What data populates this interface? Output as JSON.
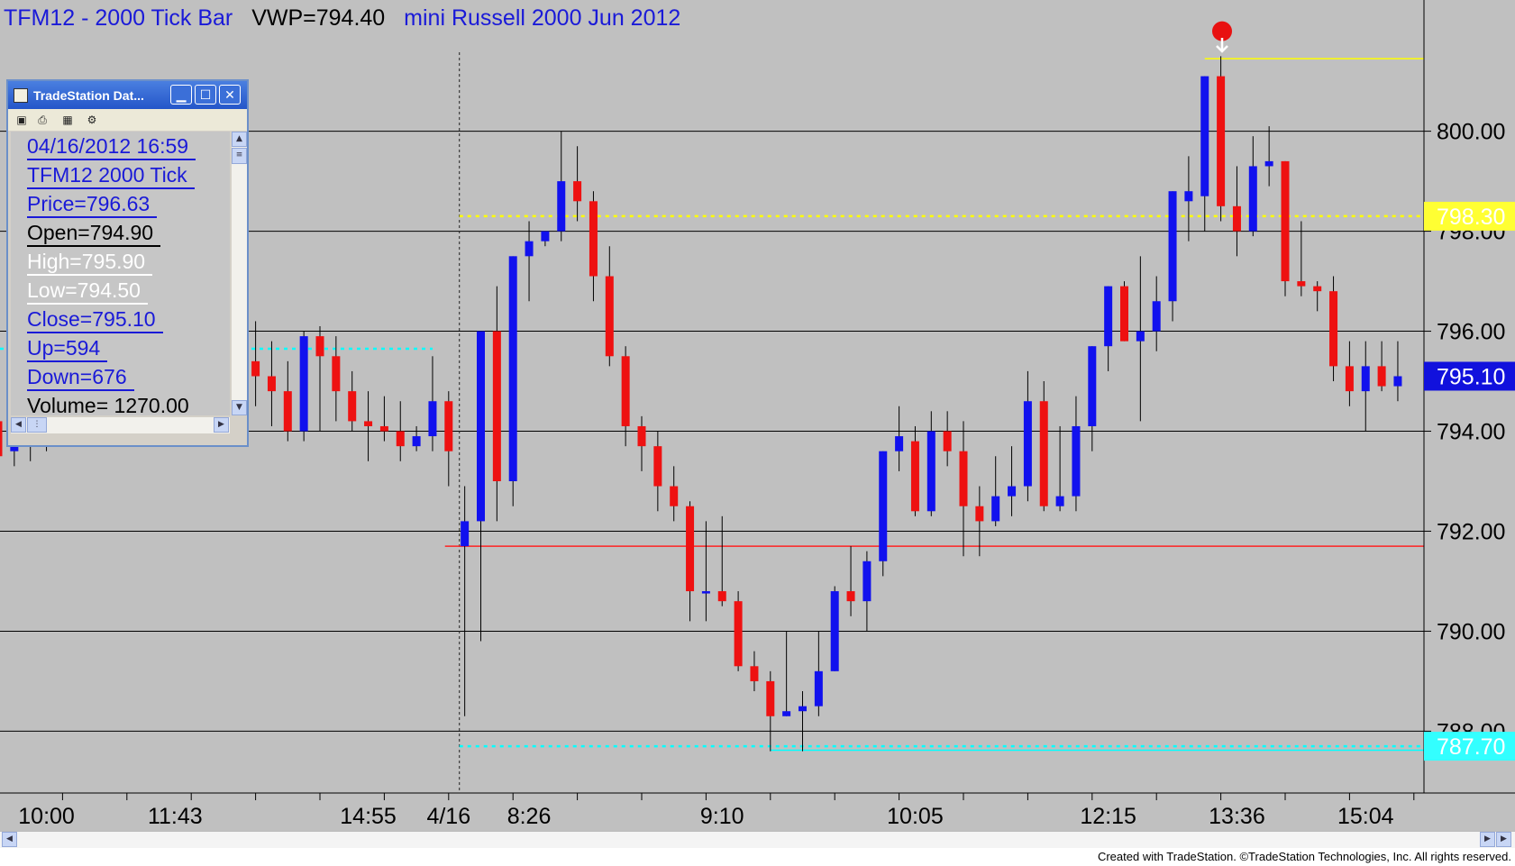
{
  "chart_data": {
    "type": "candlestick",
    "title_parts": [
      "TFM12 - 2000 Tick Bar",
      "VWP=794.40",
      "mini Russell 2000 Jun 2012"
    ],
    "y_ticks": [
      800.0,
      798.0,
      796.0,
      794.0,
      792.0,
      790.0,
      788.0
    ],
    "y_tick_labels": [
      "800.00",
      "798.00",
      "796.00",
      "794.00",
      "792.00",
      "790.00",
      "788.00"
    ],
    "ylim": [
      786.8,
      802.3
    ],
    "x_tick_labels": [
      "10:00",
      "11:43",
      "14:55",
      "4/16",
      "8:26",
      "9:10",
      "10:05",
      "12:15",
      "13:36",
      "15:04"
    ],
    "x_tick_bars": [
      3,
      11,
      23,
      28,
      33,
      45,
      57,
      69,
      77,
      85
    ],
    "bar_count": 90,
    "session_divider_bar": 29,
    "grid": true,
    "candles": [
      {
        "o": 794.2,
        "h": 794.8,
        "c": 793.5,
        "l": 793.3
      },
      {
        "o": 793.6,
        "h": 794.0,
        "c": 794.4,
        "l": 793.3
      },
      {
        "o": 794.3,
        "h": 794.6,
        "c": 793.9,
        "l": 793.4
      },
      {
        "o": 793.8,
        "h": 794.6,
        "c": 794.5,
        "l": 793.6
      },
      {
        "o": 794.5,
        "h": 795.6,
        "c": 795.2,
        "l": 794.1
      },
      {
        "o": 795.2,
        "h": 795.5,
        "c": 794.8,
        "l": 794.4
      },
      {
        "o": 794.8,
        "h": 795.2,
        "c": 795.1,
        "l": 794.5
      },
      {
        "o": 795.1,
        "h": 795.7,
        "c": 795.6,
        "l": 794.9
      },
      {
        "o": 795.6,
        "h": 796.0,
        "c": 795.3,
        "l": 795.0
      },
      {
        "o": 795.3,
        "h": 795.8,
        "c": 795.0,
        "l": 794.7
      },
      {
        "o": 795.0,
        "h": 795.4,
        "c": 794.6,
        "l": 794.3
      },
      {
        "o": 794.6,
        "h": 795.1,
        "c": 794.9,
        "l": 794.2
      },
      {
        "o": 794.9,
        "h": 795.3,
        "c": 795.6,
        "l": 794.6
      },
      {
        "o": 795.6,
        "h": 797.0,
        "c": 796.2,
        "l": 795.4
      },
      {
        "o": 796.2,
        "h": 797.4,
        "c": 796.9,
        "l": 795.9
      },
      {
        "o": 796.9,
        "h": 797.1,
        "c": 795.4,
        "l": 794.9
      },
      {
        "o": 795.4,
        "h": 796.2,
        "c": 795.1,
        "l": 794.5
      },
      {
        "o": 795.1,
        "h": 795.8,
        "c": 794.8,
        "l": 794.1
      },
      {
        "o": 794.8,
        "h": 795.4,
        "c": 794.0,
        "l": 793.8
      },
      {
        "o": 794.0,
        "h": 796.0,
        "c": 795.9,
        "l": 793.8
      },
      {
        "o": 795.9,
        "h": 796.1,
        "c": 795.5,
        "l": 794.0
      },
      {
        "o": 795.5,
        "h": 795.9,
        "c": 794.8,
        "l": 794.2
      },
      {
        "o": 794.8,
        "h": 795.2,
        "c": 794.2,
        "l": 794.0
      },
      {
        "o": 794.2,
        "h": 794.8,
        "c": 794.1,
        "l": 793.4
      },
      {
        "o": 794.1,
        "h": 794.7,
        "c": 794.0,
        "l": 793.8
      },
      {
        "o": 794.0,
        "h": 794.6,
        "c": 793.7,
        "l": 793.4
      },
      {
        "o": 793.7,
        "h": 794.1,
        "c": 793.9,
        "l": 793.6
      },
      {
        "o": 793.9,
        "h": 795.5,
        "c": 794.6,
        "l": 793.6
      },
      {
        "o": 794.6,
        "h": 794.8,
        "c": 793.6,
        "l": 792.9
      },
      {
        "o": 791.7,
        "h": 792.9,
        "c": 792.2,
        "l": 788.3
      },
      {
        "o": 792.2,
        "h": 795.0,
        "c": 796.0,
        "l": 789.8
      },
      {
        "o": 796.0,
        "h": 796.9,
        "c": 793.0,
        "l": 792.2
      },
      {
        "o": 793.0,
        "h": 797.4,
        "c": 797.5,
        "l": 792.5
      },
      {
        "o": 797.5,
        "h": 798.2,
        "c": 797.8,
        "l": 796.6
      },
      {
        "o": 797.8,
        "h": 798.0,
        "c": 798.0,
        "l": 797.7
      },
      {
        "o": 798.0,
        "h": 800.0,
        "c": 799.0,
        "l": 797.8
      },
      {
        "o": 799.0,
        "h": 799.7,
        "c": 798.6,
        "l": 798.2
      },
      {
        "o": 798.6,
        "h": 798.8,
        "c": 797.1,
        "l": 796.6
      },
      {
        "o": 797.1,
        "h": 797.7,
        "c": 795.5,
        "l": 795.3
      },
      {
        "o": 795.5,
        "h": 795.7,
        "c": 794.1,
        "l": 793.7
      },
      {
        "o": 794.1,
        "h": 794.3,
        "c": 793.7,
        "l": 793.2
      },
      {
        "o": 793.7,
        "h": 794.0,
        "c": 792.9,
        "l": 792.4
      },
      {
        "o": 792.9,
        "h": 793.3,
        "c": 792.5,
        "l": 792.2
      },
      {
        "o": 792.5,
        "h": 792.6,
        "c": 790.8,
        "l": 790.2
      },
      {
        "o": 790.8,
        "h": 792.2,
        "c": 790.8,
        "l": 790.2
      },
      {
        "o": 790.8,
        "h": 792.3,
        "c": 790.6,
        "l": 790.5
      },
      {
        "o": 790.6,
        "h": 790.8,
        "c": 789.3,
        "l": 789.2
      },
      {
        "o": 789.3,
        "h": 789.6,
        "c": 789.0,
        "l": 788.8
      },
      {
        "o": 789.0,
        "h": 789.2,
        "c": 788.3,
        "l": 787.6
      },
      {
        "o": 788.3,
        "h": 790.0,
        "c": 788.4,
        "l": 788.3
      },
      {
        "o": 788.4,
        "h": 788.8,
        "c": 788.5,
        "l": 787.6
      },
      {
        "o": 788.5,
        "h": 790.0,
        "c": 789.2,
        "l": 788.3
      },
      {
        "o": 789.2,
        "h": 790.9,
        "c": 790.8,
        "l": 789.3
      },
      {
        "o": 790.8,
        "h": 791.7,
        "c": 790.6,
        "l": 790.3
      },
      {
        "o": 790.6,
        "h": 791.6,
        "c": 791.4,
        "l": 790.0
      },
      {
        "o": 791.4,
        "h": 792.0,
        "c": 793.6,
        "l": 791.1
      },
      {
        "o": 793.6,
        "h": 794.5,
        "c": 793.9,
        "l": 793.2
      },
      {
        "o": 793.8,
        "h": 794.1,
        "c": 792.4,
        "l": 792.3
      },
      {
        "o": 792.4,
        "h": 794.4,
        "c": 794.0,
        "l": 792.3
      },
      {
        "o": 794.0,
        "h": 794.4,
        "c": 793.6,
        "l": 793.3
      },
      {
        "o": 793.6,
        "h": 794.2,
        "c": 792.5,
        "l": 791.5
      },
      {
        "o": 792.5,
        "h": 792.9,
        "c": 792.2,
        "l": 791.5
      },
      {
        "o": 792.2,
        "h": 793.5,
        "c": 792.7,
        "l": 792.1
      },
      {
        "o": 792.7,
        "h": 793.7,
        "c": 792.9,
        "l": 792.3
      },
      {
        "o": 792.9,
        "h": 795.2,
        "c": 794.6,
        "l": 792.6
      },
      {
        "o": 794.6,
        "h": 795.0,
        "c": 792.5,
        "l": 792.4
      },
      {
        "o": 792.5,
        "h": 794.1,
        "c": 792.7,
        "l": 792.4
      },
      {
        "o": 792.7,
        "h": 794.7,
        "c": 794.1,
        "l": 792.4
      },
      {
        "o": 794.1,
        "h": 795.6,
        "c": 795.7,
        "l": 793.6
      },
      {
        "o": 795.7,
        "h": 796.9,
        "c": 796.9,
        "l": 795.2
      },
      {
        "o": 796.9,
        "h": 797.0,
        "c": 795.8,
        "l": 795.8
      },
      {
        "o": 795.8,
        "h": 797.5,
        "c": 796.0,
        "l": 794.2
      },
      {
        "o": 796.0,
        "h": 797.1,
        "c": 796.6,
        "l": 795.6
      },
      {
        "o": 796.6,
        "h": 796.9,
        "c": 798.8,
        "l": 796.2
      },
      {
        "o": 798.6,
        "h": 799.5,
        "c": 798.8,
        "l": 797.8
      },
      {
        "o": 798.7,
        "h": 798.9,
        "c": 801.1,
        "l": 798.0
      },
      {
        "o": 801.1,
        "h": 801.5,
        "c": 798.5,
        "l": 798.2
      },
      {
        "o": 798.5,
        "h": 799.3,
        "c": 798.0,
        "l": 797.5
      },
      {
        "o": 798.0,
        "h": 799.9,
        "c": 799.3,
        "l": 797.9
      },
      {
        "o": 799.3,
        "h": 800.1,
        "c": 799.4,
        "l": 798.9
      },
      {
        "o": 799.4,
        "h": 799.2,
        "c": 797.0,
        "l": 796.7
      },
      {
        "o": 797.0,
        "h": 798.2,
        "c": 796.9,
        "l": 796.7
      },
      {
        "o": 796.9,
        "h": 797.0,
        "c": 796.8,
        "l": 796.4
      },
      {
        "o": 796.8,
        "h": 797.1,
        "c": 795.3,
        "l": 795.0
      },
      {
        "o": 795.3,
        "h": 795.8,
        "c": 794.8,
        "l": 794.5
      },
      {
        "o": 794.8,
        "h": 795.8,
        "c": 795.3,
        "l": 794.0
      },
      {
        "o": 795.3,
        "h": 795.8,
        "c": 794.9,
        "l": 794.8
      },
      {
        "o": 794.9,
        "h": 795.8,
        "c": 795.1,
        "l": 794.6
      }
    ],
    "levels": {
      "yellow_dotted": 798.3,
      "cyan_dotted": 787.7,
      "red_line": 791.7,
      "yellow_top": 801.45,
      "last_price": 795.1
    },
    "price_tags": [
      {
        "label": "798.30",
        "value": 798.3,
        "bg": "#ffff33",
        "fg": "#ffffff"
      },
      {
        "label": "795.10",
        "value": 795.1,
        "bg": "#1111dd",
        "fg": "#ffffff"
      },
      {
        "label": "787.70",
        "value": 787.7,
        "bg": "#33ffff",
        "fg": "#ffffff"
      }
    ]
  },
  "colors": {
    "plot_bg": "#c0c0c0",
    "up": "#1111ee",
    "down": "#ee1111",
    "grid": "#000000",
    "title": "#1a1ad8"
  },
  "data_window": {
    "title": "TradeStation Dat...",
    "fields": [
      {
        "text": "04/16/2012 16:59",
        "style": "link"
      },
      {
        "text": "TFM12 2000 Tick",
        "style": "link"
      },
      {
        "text": "Price=796.63",
        "style": "link"
      },
      {
        "text": "Open=794.90",
        "style": "black"
      },
      {
        "text": "High=795.90",
        "style": "white"
      },
      {
        "text": "Low=794.50",
        "style": "white"
      },
      {
        "text": "Close=795.10",
        "style": "link"
      },
      {
        "text": "Up=594",
        "style": "link"
      },
      {
        "text": "Down=676",
        "style": "link"
      },
      {
        "text": "Volume= 1270.00",
        "style": "black"
      }
    ]
  },
  "footer": {
    "credit": "Created with TradeStation. ©TradeStation Technologies, Inc. All rights reserved."
  }
}
